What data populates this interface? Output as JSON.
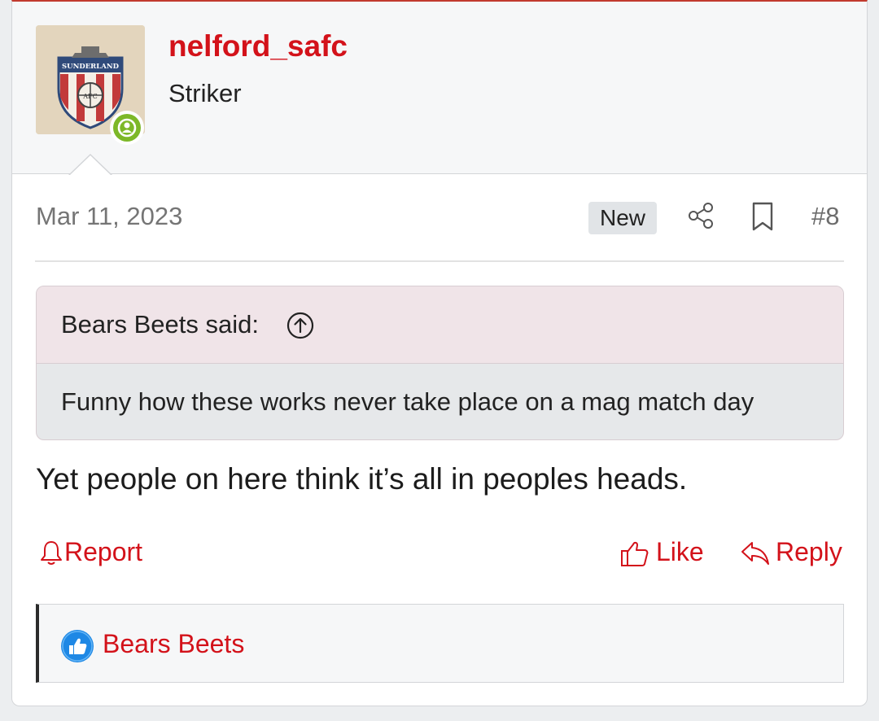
{
  "post": {
    "username": "nelford_safc",
    "user_title": "Striker",
    "avatar_text": "SUNDERLAND",
    "avatar_badge": "AFC",
    "date": "Mar 11, 2023",
    "new_badge": "New",
    "post_number": "#8",
    "quote": {
      "author_label": "Bears Beets said:",
      "text": "Funny how these works never take place on a mag match day"
    },
    "body": "Yet people on here think it’s all in peoples heads.",
    "actions": {
      "report": "Report",
      "like": "Like",
      "reply": "Reply"
    },
    "reactions": {
      "icon": "thumbs-up-icon",
      "users": "Bears Beets"
    }
  },
  "colors": {
    "accent": "#d3121a",
    "online": "#7db828",
    "like_badge": "#1e88e5",
    "quote_header_bg": "#f0e4e8",
    "quote_body_bg": "#e6e8ea"
  }
}
